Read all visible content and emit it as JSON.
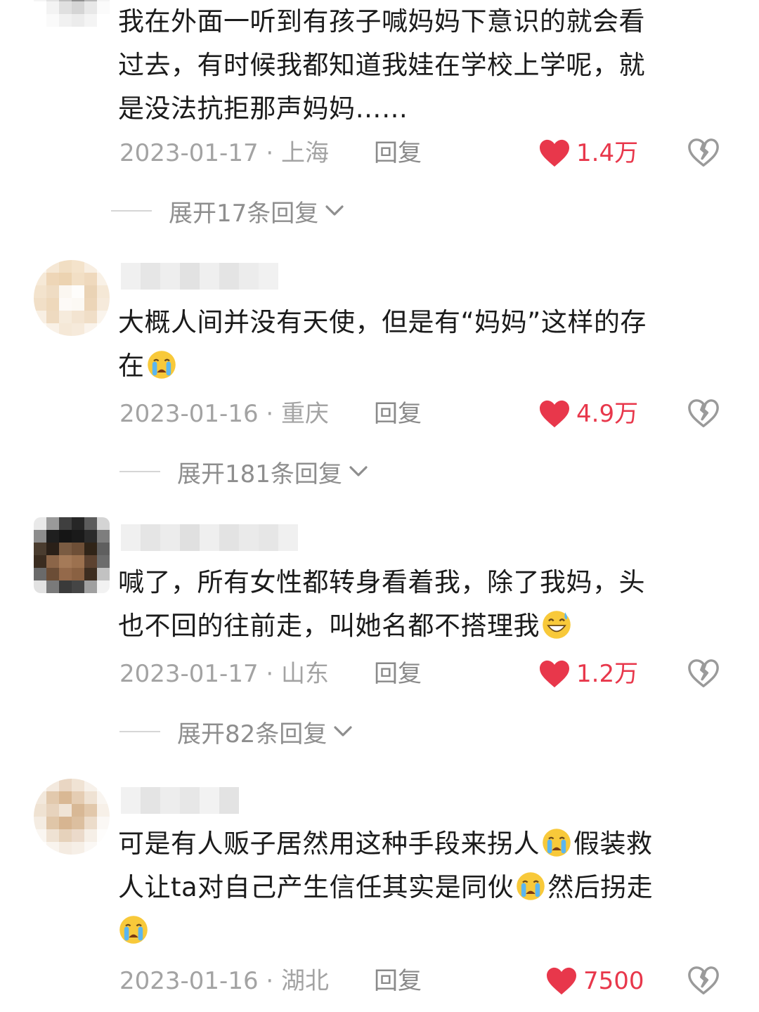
{
  "comments": [
    {
      "text_lines": [
        "我在外面一听到有孩子喊妈妈下意识的就会看",
        "过去，有时候我都知道我娃在学校上学呢，就",
        "是没法抗拒那声妈妈……"
      ],
      "date": "2023-01-17",
      "location": "上海",
      "reply_label": "回复",
      "likes": "1.4万",
      "expand_label": "展开17条回复"
    },
    {
      "text_lines": [
        "大概人间并没有天使，但是有“妈妈”这样的存",
        "在"
      ],
      "emoji_after_line": "loudly-crying-emoji",
      "date": "2023-01-16",
      "location": "重庆",
      "reply_label": "回复",
      "likes": "4.9万",
      "expand_label": "展开181条回复"
    },
    {
      "text_lines": [
        "喊了，所有女性都转身看着我，除了我妈，头",
        "也不回的往前走，叫她名都不搭理我"
      ],
      "emoji_after_line": "grinning-sweat-emoji",
      "date": "2023-01-17",
      "location": "山东",
      "reply_label": "回复",
      "likes": "1.2万",
      "expand_label": "展开82条回复"
    },
    {
      "text_parts": [
        "可是有人贩子居然用这种手段来拐人",
        "假装救",
        "人让ta对自己产生信任其实是同伙",
        "然后拐走"
      ],
      "emoji": "loudly-crying-emoji",
      "date": "2023-01-16",
      "location": "湖北",
      "reply_label": "回复",
      "likes": "7500"
    }
  ],
  "separator": "·",
  "colors": {
    "like_red": "#e8374b",
    "meta_gray": "#a3a3a3",
    "text": "#1b1b1b"
  },
  "icons": [
    "heart-icon",
    "broken-heart-icon",
    "chevron-down-icon",
    "loudly-crying-emoji",
    "grinning-sweat-emoji"
  ]
}
